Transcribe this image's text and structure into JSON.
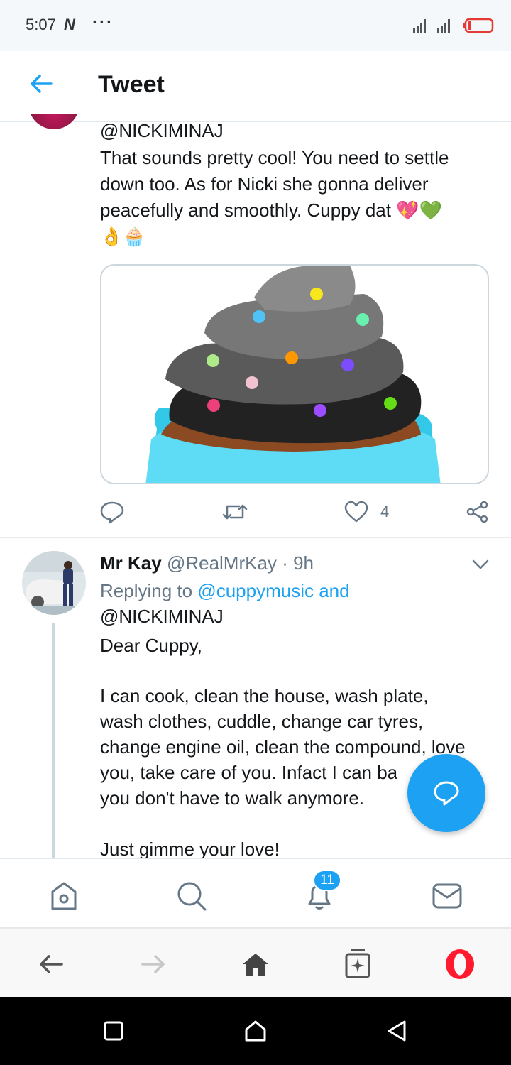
{
  "status_bar": {
    "time": "5:07",
    "app_glyph": "N",
    "more": "···"
  },
  "header": {
    "title": "Tweet"
  },
  "tweet1": {
    "mention": "@NICKIMINAJ",
    "line1": "That sounds pretty cool! You need to settle",
    "line2": "down too. As for Nicki she gonna deliver",
    "line3": "peacefully and smoothly. Cuppy dat 💖💚",
    "line4": "👌🧁",
    "like_count": "4"
  },
  "tweet2": {
    "name": "Mr Kay",
    "handle": "@RealMrKay",
    "separator": "·",
    "time": "9h",
    "replying_prefix": "Replying to",
    "replying_handle1": "@cuppymusic and",
    "replying_handle2": "@NICKIMINAJ",
    "greeting": "Dear Cuppy,",
    "body_lines": [
      "I can cook, clean the house, wash plate,",
      "wash clothes, cuddle, change car tyres,",
      "change engine oil, clean the compound, love",
      "you, take care of you. Infact I can ba",
      "you don't have to walk anymore."
    ],
    "closing": "Just gimme your love!"
  },
  "tabbar": {
    "notifications_badge": "11"
  },
  "colors": {
    "accent": "#1da1f2",
    "text": "#14171a",
    "muted": "#657786"
  },
  "icons": [
    "back-arrow-icon",
    "reply-icon",
    "retweet-icon",
    "heart-icon",
    "share-icon",
    "chevron-down-icon",
    "compose-icon",
    "home-icon",
    "search-icon",
    "bell-icon",
    "mail-icon",
    "browser-back-icon",
    "browser-forward-icon",
    "browser-home-icon",
    "tabs-icon",
    "opera-icon",
    "recents-icon",
    "android-home-icon",
    "android-back-icon"
  ]
}
